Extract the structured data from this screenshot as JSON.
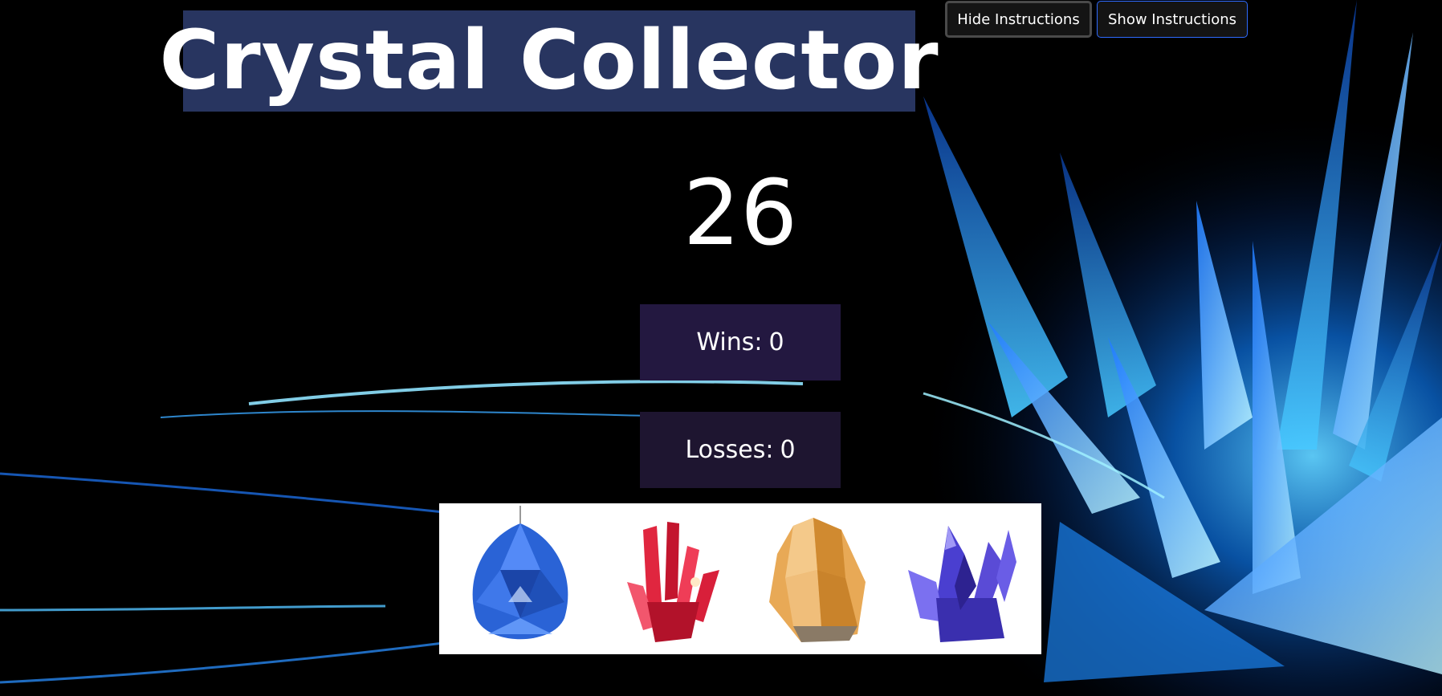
{
  "title": "Crystal Collector",
  "buttons": {
    "hide_label": "Hide Instructions",
    "show_label": "Show Instructions"
  },
  "target_number": "26",
  "stats": {
    "wins_label": "Wins:",
    "wins_value": "0",
    "losses_label": "Losses:",
    "losses_value": "0"
  },
  "crystals": [
    {
      "name": "blue-crystal",
      "color": "#2a63d6"
    },
    {
      "name": "red-crystal",
      "color": "#d81f3a"
    },
    {
      "name": "amber-crystal",
      "color": "#e0a24a"
    },
    {
      "name": "purple-crystal",
      "color": "#5a4bd6"
    }
  ],
  "colors": {
    "title_bg": "#283560",
    "wins_bg": "#231840",
    "losses_bg": "#1e1530",
    "background_glow": "#1e90ff"
  }
}
